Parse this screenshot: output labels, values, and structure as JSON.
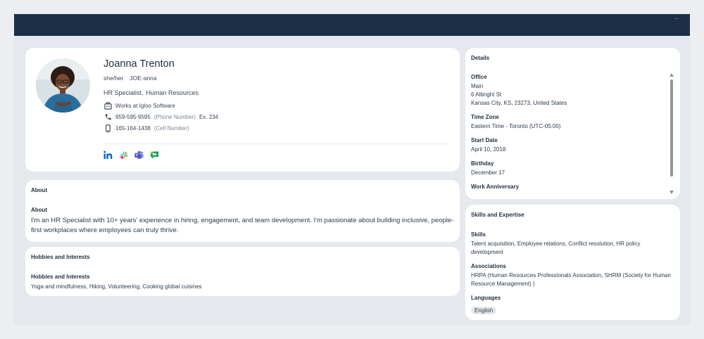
{
  "profile": {
    "name": "Joanna Trenton",
    "pronouns": "she/her",
    "pronunciation": "JOE-anna",
    "job_title": "HR Specialist,",
    "department": "Human Resources",
    "company": "Works at Igloo Software",
    "phone": "959-595-9595",
    "phone_label": "(Phone Number)",
    "phone_ext": "Ex. 234",
    "cell": "165-164-1438",
    "cell_label": "(Cell Number)",
    "social_icons": [
      "linkedin-icon",
      "slack-icon",
      "teams-icon",
      "google-chat-icon"
    ]
  },
  "about": {
    "section_title": "About",
    "label": "About",
    "text": "I'm an HR Specialist with 10+ years' experience in hiring, engagement, and team development. I'm passionate about building inclusive, people-first workplaces where employees can truly thrive."
  },
  "hobbies": {
    "section_title": "Hobbies and Interests",
    "label": "Hobbies and Interests",
    "text": "Yoga and mindfulness, Hiking, Volunteering, Cooking global cuisines"
  },
  "details": {
    "section_title": "Details",
    "office_label": "Office",
    "office_name": "Main",
    "office_street": "6 Albright St",
    "office_city": "Kansas City, KS, 23273, United States",
    "timezone_label": "Time Zone",
    "timezone": "Eastern Time - Toronto (UTC-05:00)",
    "start_label": "Start Date",
    "start_date": "April 10, 2018",
    "birthday_label": "Birthday",
    "birthday": "December 17",
    "anniversary_label": "Work Anniversary"
  },
  "skills": {
    "section_title": "Skills and Expertise",
    "skills_label": "Skills",
    "skills": "Talent acquisition, Employee relations, Conflict resolution, HR policy development",
    "associations_label": "Associations",
    "associations": "HRPA (Human Resources Professionals Association, SHRM (Society for Human Resource Management) )",
    "languages_label": "Languages",
    "languages": [
      "English"
    ]
  },
  "colors": {
    "topbar": "#1b2f47",
    "page": "#e5e8ec",
    "card": "#ffffff",
    "linkedin": "#0a66c2",
    "teams": "#5b5fc7"
  }
}
